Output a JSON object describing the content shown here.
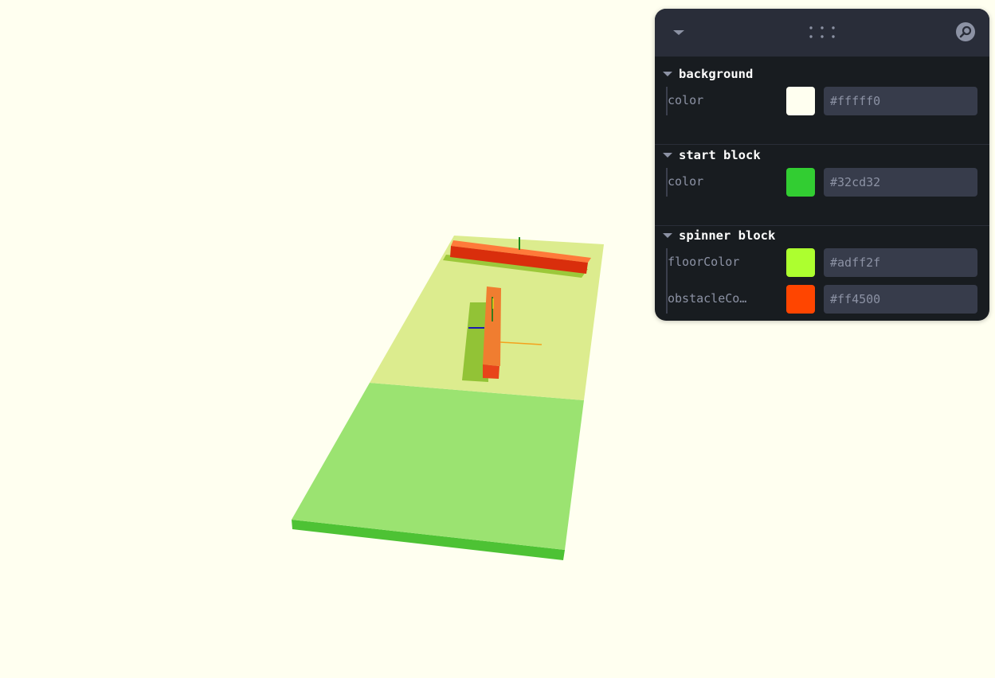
{
  "colors": {
    "page_background": "#fffff0",
    "panel_bg": "#181c20",
    "panel_header_bg": "#292d39",
    "input_bg": "#373c4b"
  },
  "header": {
    "collapse_icon": "caret-down-icon",
    "drag_icon": "drag-dots-icon",
    "search_icon": "search-icon"
  },
  "folders": [
    {
      "title": "background",
      "controls": [
        {
          "label": "color",
          "value": "#fffff0"
        }
      ]
    },
    {
      "title": "start block",
      "controls": [
        {
          "label": "color",
          "value": "#32cd32"
        }
      ]
    },
    {
      "title": "spinner block",
      "controls": [
        {
          "label": "floorColor",
          "value": "#adff2f"
        },
        {
          "label": "obstacleCo…",
          "value": "#ff4500"
        }
      ]
    }
  ]
}
